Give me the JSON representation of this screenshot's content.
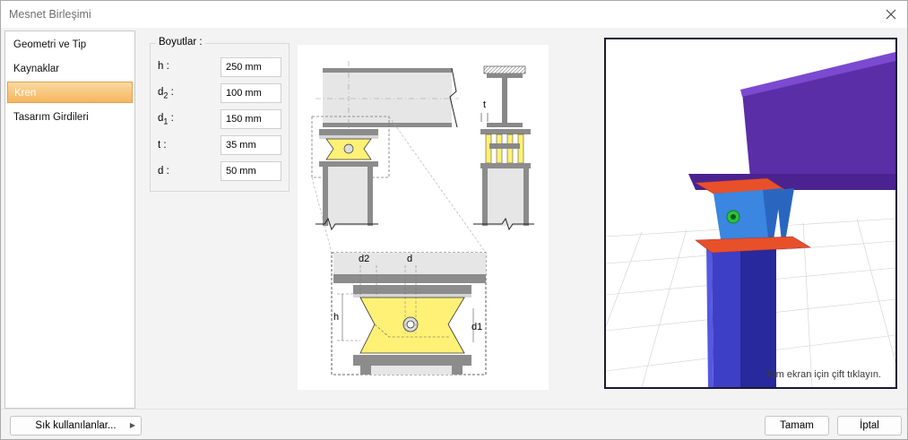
{
  "window": {
    "title": "Mesnet Birleşimi"
  },
  "sidebar": {
    "items": [
      {
        "label": "Geometri ve Tip",
        "active": false
      },
      {
        "label": "Kaynaklar",
        "active": false
      },
      {
        "label": "Kren",
        "active": true
      },
      {
        "label": "Tasarım Girdileri",
        "active": false
      }
    ]
  },
  "dimensions": {
    "title": "Boyutlar :",
    "rows": [
      {
        "label": "h",
        "sub": "",
        "value": "250 mm"
      },
      {
        "label": "d",
        "sub": "2",
        "value": "100 mm"
      },
      {
        "label": "d",
        "sub": "1",
        "value": "150 mm"
      },
      {
        "label": "t",
        "sub": "",
        "value": "35 mm"
      },
      {
        "label": "d",
        "sub": "",
        "value": "50 mm"
      }
    ]
  },
  "drawing": {
    "labels": {
      "t": "t",
      "d2": "d2",
      "d": "d",
      "h": "h",
      "d1": "d1"
    }
  },
  "viewport": {
    "hint": "Tam ekran için çift tıklayın."
  },
  "footer": {
    "favorites_label": "Sık kullanılanlar...",
    "ok_label": "Tamam",
    "cancel_label": "İptal"
  },
  "colors": {
    "beam": "#5a2ea6",
    "column": "#3d3fc7",
    "plate": "#e8502a",
    "stiffener": "#3a86e0",
    "bolt": "#2bc23c",
    "highlight": "#fff176"
  }
}
